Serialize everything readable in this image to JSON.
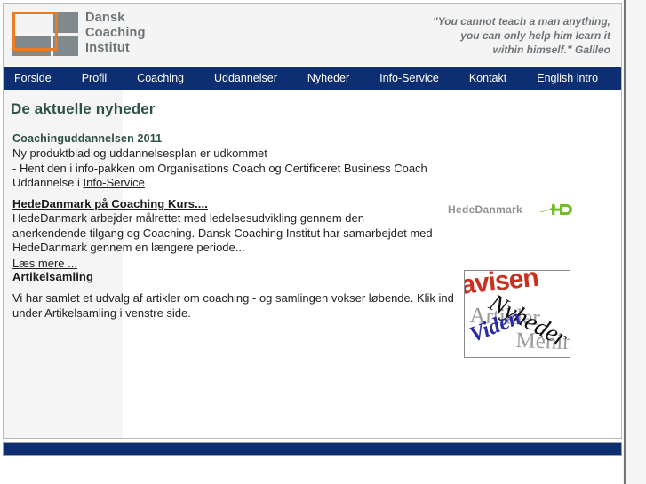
{
  "header": {
    "logo": {
      "name": "dansk-coaching-institut-logo",
      "lines": [
        "Dansk",
        "Coaching",
        "Institut"
      ],
      "accent_color": "#ef7b21",
      "block_color": "#808a8d",
      "text_color": "#6d7478"
    },
    "quote": {
      "lines": [
        "\"You cannot teach a man anything,",
        "you can only help him learn it",
        "within himself.\" Galileo"
      ]
    }
  },
  "nav": {
    "background": "#0d2f72",
    "items": [
      {
        "label": "Forside",
        "name": "nav-forside"
      },
      {
        "label": "Profil",
        "name": "nav-profil"
      },
      {
        "label": "Coaching",
        "name": "nav-coaching"
      },
      {
        "label": "Uddannelser",
        "name": "nav-uddannelser"
      },
      {
        "label": "Nyheder",
        "name": "nav-nyheder"
      },
      {
        "label": "Info-Service",
        "name": "nav-info-service"
      },
      {
        "label": "Kontakt",
        "name": "nav-kontakt"
      },
      {
        "label": "English intro",
        "name": "nav-english-intro"
      }
    ]
  },
  "main": {
    "page_title": "De aktuelle nyheder",
    "title_color": "#2d5146",
    "news": [
      {
        "heading": "Coachinguddannelsen 2011",
        "line1": "Ny produktblad og uddannelsesplan er udkommet",
        "line2_prefix": "- Hent den i info-pakken om Organisations Coach og Certificeret Business Coach Uddannelse i ",
        "line2_link": "Info-Service"
      },
      {
        "heading": "HedeDanmark på Coaching Kurs....",
        "body": "HedeDanmark arbejder målrettet med ledelsesudvikling gennem den anerkendende tilgang og Coaching. Dansk Coaching Institut har samarbejdet med HedeDanmark gennem en længere periode...",
        "more_link": "Læs mere ...",
        "logo_text": "HedeDanmark",
        "logo_mark_color": "#74bd26"
      },
      {
        "heading": "Artikelsamling",
        "body": "Vi har samlet et udvalg af artikler om coaching - og samlingen vokser løbende. Klik ind under Artikelsamling i venstre side.",
        "image_words": {
          "avisen": "avisen",
          "nyheder": "Nyheder",
          "artikler": "Artikler",
          "viden": "Viden",
          "mening": "Mening"
        }
      }
    ]
  },
  "footer": {
    "background": "#0d2f72"
  }
}
